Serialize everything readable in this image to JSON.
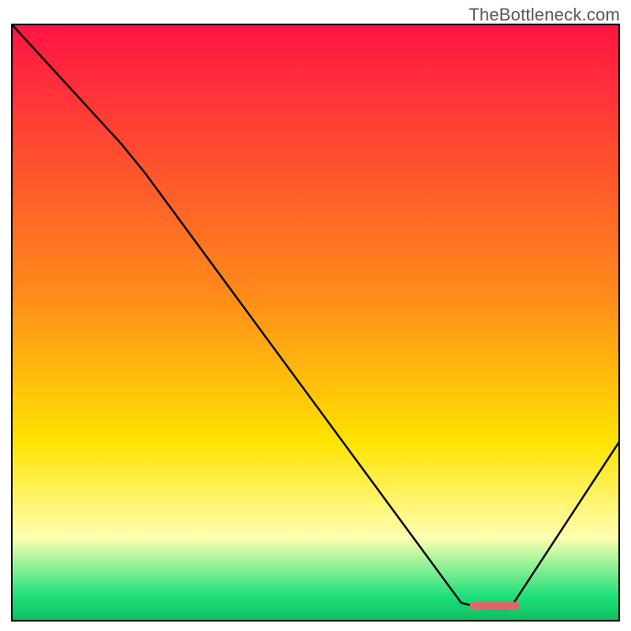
{
  "watermark": "TheBottleneck.com",
  "colors": {
    "gradient_top": "#ff1444",
    "gradient_orange": "#ff8a1a",
    "gradient_yellow": "#ffe300",
    "gradient_pale": "#ffffb0",
    "gradient_green": "#1be07a",
    "curve": "#000000",
    "segment": "#e06666",
    "border": "#000000"
  },
  "chart_data": {
    "type": "line",
    "title": "",
    "xlabel": "",
    "ylabel": "",
    "xlim": [
      0,
      100
    ],
    "ylim": [
      0,
      100
    ],
    "grid": false,
    "legend": false,
    "gradient_stops": [
      {
        "offset": 0,
        "color": "#ff1444"
      },
      {
        "offset": 45,
        "color": "#ff8a1a"
      },
      {
        "offset": 70,
        "color": "#ffe300"
      },
      {
        "offset": 86,
        "color": "#ffffb0"
      },
      {
        "offset": 96,
        "color": "#1be07a"
      },
      {
        "offset": 100,
        "color": "#0dbc5f"
      }
    ],
    "series": [
      {
        "name": "bottleneck-curve",
        "x": [
          0,
          18,
          22,
          74,
          78,
          82,
          100
        ],
        "values": [
          100,
          80,
          75,
          3,
          2,
          2,
          30
        ]
      }
    ],
    "highlight_segment": {
      "name": "min-plateau",
      "x_start": 76,
      "x_end": 83,
      "y": 2.5
    }
  }
}
